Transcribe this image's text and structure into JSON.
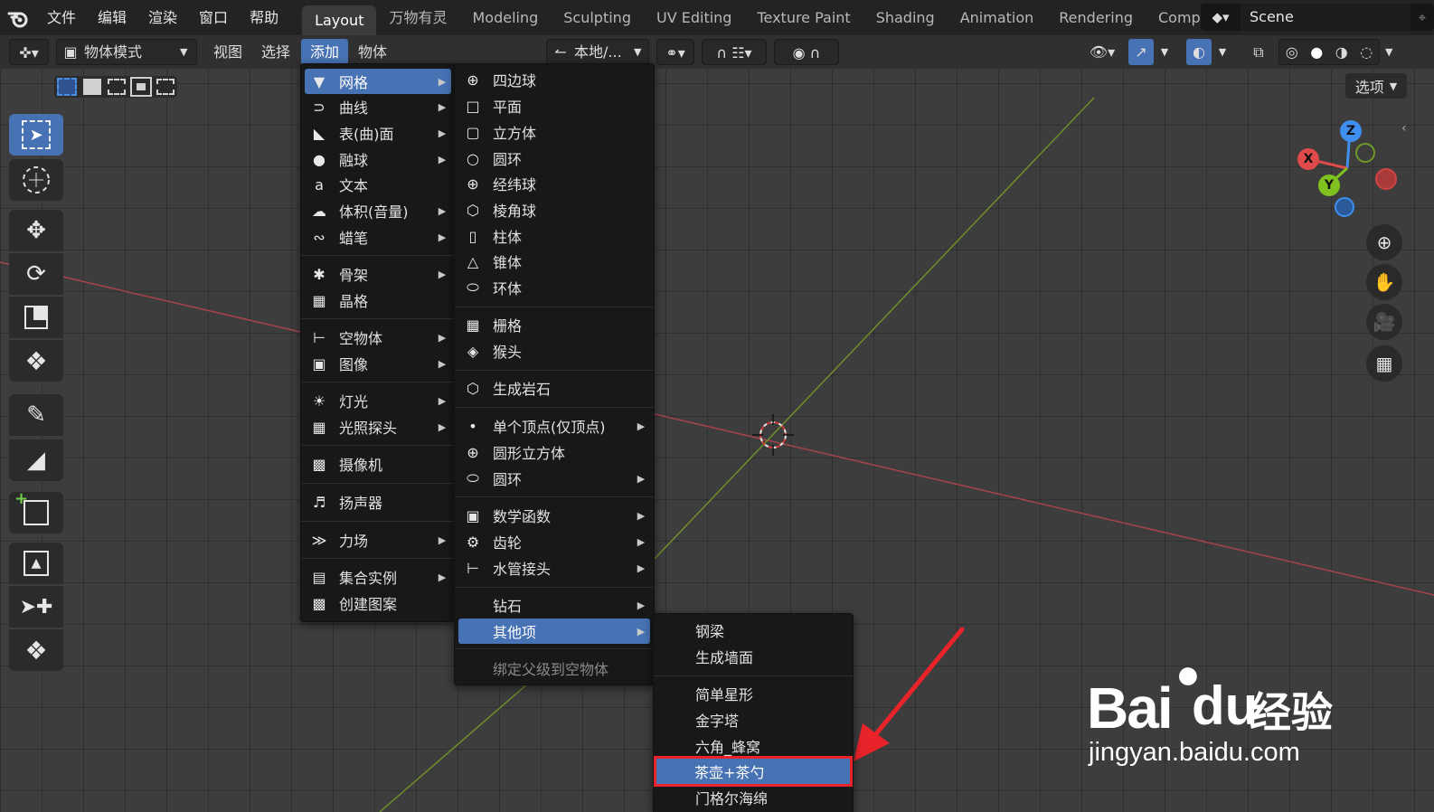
{
  "topbar": {
    "menus": [
      "文件",
      "编辑",
      "渲染",
      "窗口",
      "帮助"
    ],
    "workspaces": [
      "Layout",
      "万物有灵",
      "Modeling",
      "Sculpting",
      "UV Editing",
      "Texture Paint",
      "Shading",
      "Animation",
      "Rendering",
      "Compo"
    ],
    "active_workspace": "Layout",
    "scene_name": "Scene"
  },
  "header": {
    "mode": "物体模式",
    "menus": [
      "视图",
      "选择",
      "添加",
      "物体"
    ],
    "active_menu": "添加",
    "orientation": "本地/...",
    "options_label": "选项"
  },
  "add_menu": {
    "items": [
      {
        "label": "网格",
        "icon": "mesh-icon",
        "arrow": true,
        "highlight": true
      },
      {
        "label": "曲线",
        "icon": "curve-icon",
        "arrow": true
      },
      {
        "label": "表(曲)面",
        "icon": "surface-icon",
        "arrow": true
      },
      {
        "label": "融球",
        "icon": "metaball-icon",
        "arrow": true
      },
      {
        "label": "文本",
        "icon": "text-icon",
        "arrow": false
      },
      {
        "label": "体积(音量)",
        "icon": "volume-icon",
        "arrow": true
      },
      {
        "label": "蜡笔",
        "icon": "grease-pencil-icon",
        "arrow": true
      },
      {
        "label": "骨架",
        "icon": "armature-icon",
        "arrow": true
      },
      {
        "label": "晶格",
        "icon": "lattice-icon",
        "arrow": false
      },
      {
        "label": "空物体",
        "icon": "empty-icon",
        "arrow": true
      },
      {
        "label": "图像",
        "icon": "image-icon",
        "arrow": true
      },
      {
        "label": "灯光",
        "icon": "light-icon",
        "arrow": true
      },
      {
        "label": "光照探头",
        "icon": "light-probe-icon",
        "arrow": true
      },
      {
        "label": "摄像机",
        "icon": "camera-icon",
        "arrow": false
      },
      {
        "label": "扬声器",
        "icon": "speaker-icon",
        "arrow": false
      },
      {
        "label": "力场",
        "icon": "force-field-icon",
        "arrow": true
      },
      {
        "label": "集合实例",
        "icon": "collection-icon",
        "arrow": true
      },
      {
        "label": "创建图案",
        "icon": "pattern-icon",
        "arrow": false
      }
    ]
  },
  "mesh_menu": {
    "items": [
      {
        "label": "四边球",
        "icon": "quad-sphere-icon",
        "arrow": false
      },
      {
        "label": "平面",
        "icon": "plane-icon",
        "arrow": false
      },
      {
        "label": "立方体",
        "icon": "cube-icon",
        "arrow": false
      },
      {
        "label": "圆环",
        "icon": "circle-icon",
        "arrow": false
      },
      {
        "label": "经纬球",
        "icon": "uv-sphere-icon",
        "arrow": false
      },
      {
        "label": "棱角球",
        "icon": "ico-sphere-icon",
        "arrow": false
      },
      {
        "label": "柱体",
        "icon": "cylinder-icon",
        "arrow": false
      },
      {
        "label": "锥体",
        "icon": "cone-icon",
        "arrow": false
      },
      {
        "label": "环体",
        "icon": "torus-icon",
        "arrow": false
      },
      {
        "label": "栅格",
        "icon": "grid-icon",
        "arrow": false
      },
      {
        "label": "猴头",
        "icon": "monkey-icon",
        "arrow": false
      },
      {
        "label": "生成岩石",
        "icon": "rock-icon",
        "arrow": false
      },
      {
        "label": "单个顶点(仅顶点)",
        "icon": "vertex-icon",
        "arrow": true
      },
      {
        "label": "圆形立方体",
        "icon": "round-cube-icon",
        "arrow": false
      },
      {
        "label": "圆环",
        "icon": "torus-objects-icon",
        "arrow": true
      },
      {
        "label": "数学函数",
        "icon": "math-function-icon",
        "arrow": true
      },
      {
        "label": "齿轮",
        "icon": "gear-icon",
        "arrow": true
      },
      {
        "label": "水管接头",
        "icon": "pipe-joint-icon",
        "arrow": true
      },
      {
        "label": "钻石",
        "icon": "",
        "arrow": true
      },
      {
        "label": "其他项",
        "icon": "",
        "arrow": true,
        "highlight": true
      },
      {
        "label": "绑定父级到空物体",
        "icon": "",
        "arrow": false,
        "dim": true
      }
    ]
  },
  "extras_menu": {
    "items": [
      {
        "label": "钢梁"
      },
      {
        "label": "生成墙面"
      },
      {
        "label": "简单星形"
      },
      {
        "label": "金字塔"
      },
      {
        "label": "六角_蜂窝"
      },
      {
        "label": "茶壶+茶勺",
        "highlight": true
      },
      {
        "label": "门格尔海绵"
      }
    ]
  },
  "gizmo": {
    "x": "X",
    "y": "Y",
    "z": "Z"
  },
  "watermark": {
    "brand": "Bai",
    "brand2": "du",
    "cn": "经验",
    "url": "jingyan.baidu.com"
  },
  "colors": {
    "accent": "#4772b3",
    "annotation_red": "#e8242a",
    "x_axis": "#e04a4a",
    "y_axis": "#7fc11e",
    "z_axis": "#3f8ff0"
  }
}
